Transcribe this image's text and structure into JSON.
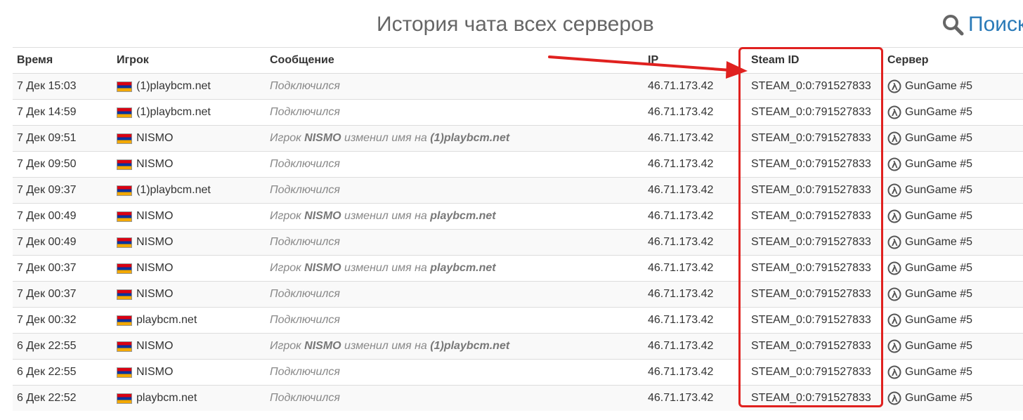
{
  "page": {
    "title": "История чата всех серверов",
    "search_label": "Поиск"
  },
  "table": {
    "headers": {
      "time": "Время",
      "player": "Игрок",
      "message": "Сообщение",
      "ip": "IP",
      "steam_id": "Steam ID",
      "server": "Сервер"
    },
    "rows": [
      {
        "time": "7 Дек 15:03",
        "player": "(1)playbcm.net",
        "message_type": "connect",
        "message": "Подключился",
        "ip": "46.71.173.42",
        "steam_id": "STEAM_0:0:791527833",
        "server": "GunGame #5"
      },
      {
        "time": "7 Дек 14:59",
        "player": "(1)playbcm.net",
        "message_type": "connect",
        "message": "Подключился",
        "ip": "46.71.173.42",
        "steam_id": "STEAM_0:0:791527833",
        "server": "GunGame #5"
      },
      {
        "time": "7 Дек 09:51",
        "player": "NISMO",
        "message_type": "rename",
        "message_prefix": "Игрок",
        "message_old": "NISMO",
        "message_mid": "изменил имя на",
        "message_new": "(1)playbcm.net",
        "ip": "46.71.173.42",
        "steam_id": "STEAM_0:0:791527833",
        "server": "GunGame #5"
      },
      {
        "time": "7 Дек 09:50",
        "player": "NISMO",
        "message_type": "connect",
        "message": "Подключился",
        "ip": "46.71.173.42",
        "steam_id": "STEAM_0:0:791527833",
        "server": "GunGame #5"
      },
      {
        "time": "7 Дек 09:37",
        "player": "(1)playbcm.net",
        "message_type": "connect",
        "message": "Подключился",
        "ip": "46.71.173.42",
        "steam_id": "STEAM_0:0:791527833",
        "server": "GunGame #5"
      },
      {
        "time": "7 Дек 00:49",
        "player": "NISMO",
        "message_type": "rename",
        "message_prefix": "Игрок",
        "message_old": "NISMO",
        "message_mid": "изменил имя на",
        "message_new": "playbcm.net",
        "ip": "46.71.173.42",
        "steam_id": "STEAM_0:0:791527833",
        "server": "GunGame #5"
      },
      {
        "time": "7 Дек 00:49",
        "player": "NISMO",
        "message_type": "connect",
        "message": "Подключился",
        "ip": "46.71.173.42",
        "steam_id": "STEAM_0:0:791527833",
        "server": "GunGame #5"
      },
      {
        "time": "7 Дек 00:37",
        "player": "NISMO",
        "message_type": "rename",
        "message_prefix": "Игрок",
        "message_old": "NISMO",
        "message_mid": "изменил имя на",
        "message_new": "playbcm.net",
        "ip": "46.71.173.42",
        "steam_id": "STEAM_0:0:791527833",
        "server": "GunGame #5"
      },
      {
        "time": "7 Дек 00:37",
        "player": "NISMO",
        "message_type": "connect",
        "message": "Подключился",
        "ip": "46.71.173.42",
        "steam_id": "STEAM_0:0:791527833",
        "server": "GunGame #5"
      },
      {
        "time": "7 Дек 00:32",
        "player": "playbcm.net",
        "message_type": "connect",
        "message": "Подключился",
        "ip": "46.71.173.42",
        "steam_id": "STEAM_0:0:791527833",
        "server": "GunGame #5"
      },
      {
        "time": "6 Дек 22:55",
        "player": "NISMO",
        "message_type": "rename",
        "message_prefix": "Игрок",
        "message_old": "NISMO",
        "message_mid": "изменил имя на",
        "message_new": "(1)playbcm.net",
        "ip": "46.71.173.42",
        "steam_id": "STEAM_0:0:791527833",
        "server": "GunGame #5"
      },
      {
        "time": "6 Дек 22:55",
        "player": "NISMO",
        "message_type": "connect",
        "message": "Подключился",
        "ip": "46.71.173.42",
        "steam_id": "STEAM_0:0:791527833",
        "server": "GunGame #5"
      },
      {
        "time": "6 Дек 22:52",
        "player": "playbcm.net",
        "message_type": "connect",
        "message": "Подключился",
        "ip": "46.71.173.42",
        "steam_id": "STEAM_0:0:791527833",
        "server": "GunGame #5"
      }
    ]
  },
  "annotation": {
    "color": "#e0211f"
  },
  "colors": {
    "link": "#2a7ab8",
    "muted_text": "#888888"
  },
  "icons": {
    "search": "search-icon",
    "flag": "armenia-flag-icon",
    "server": "half-life-icon"
  }
}
